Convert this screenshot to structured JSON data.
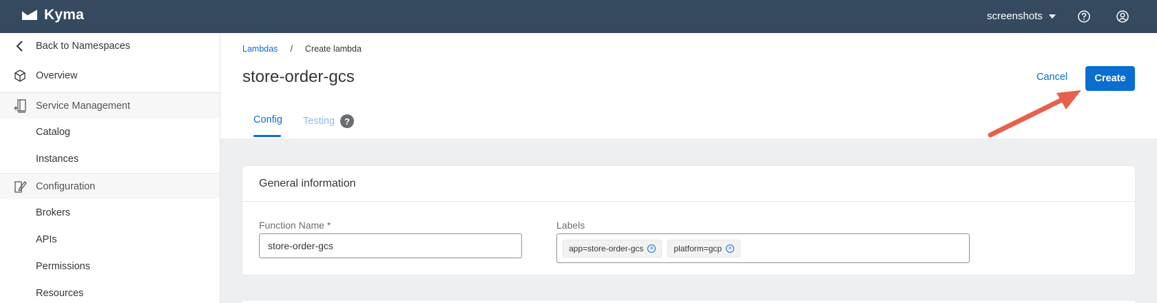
{
  "shell": {
    "brand": "Kyma",
    "namespace": "screenshots",
    "help_icon": "question-circle-icon",
    "user_icon": "user-circle-icon"
  },
  "sidebar": {
    "back": {
      "label": "Back to Namespaces",
      "icon": "chevron-left-icon"
    },
    "overview": {
      "label": "Overview",
      "icon": "cube-icon"
    },
    "groups": [
      {
        "label": "Service Management",
        "icon": "service-management-icon",
        "items": [
          "Catalog",
          "Instances"
        ]
      },
      {
        "label": "Configuration",
        "icon": "edit-document-icon",
        "items": [
          "Brokers",
          "APIs",
          "Permissions",
          "Resources"
        ]
      }
    ]
  },
  "breadcrumb": {
    "parent": "Lambdas",
    "separator": "/",
    "current": "Create lambda"
  },
  "page": {
    "title": "store-order-gcs"
  },
  "actions": {
    "cancel": "Cancel",
    "create": "Create"
  },
  "tabs": [
    {
      "label": "Config",
      "active": true
    },
    {
      "label": "Testing",
      "active": false,
      "help": "?"
    }
  ],
  "general_info": {
    "heading": "General information",
    "function_name_label": "Function Name *",
    "function_name_value": "store-order-gcs",
    "labels_label": "Labels",
    "labels": [
      {
        "text": "app=store-order-gcs",
        "remove": "⊗"
      },
      {
        "text": "platform=gcp",
        "remove": "⊗"
      }
    ]
  },
  "colors": {
    "shell_bg": "#354a5f",
    "accent": "#0a6ed1",
    "content_bg": "#edeff0",
    "annotation_arrow": "#e8604c"
  }
}
